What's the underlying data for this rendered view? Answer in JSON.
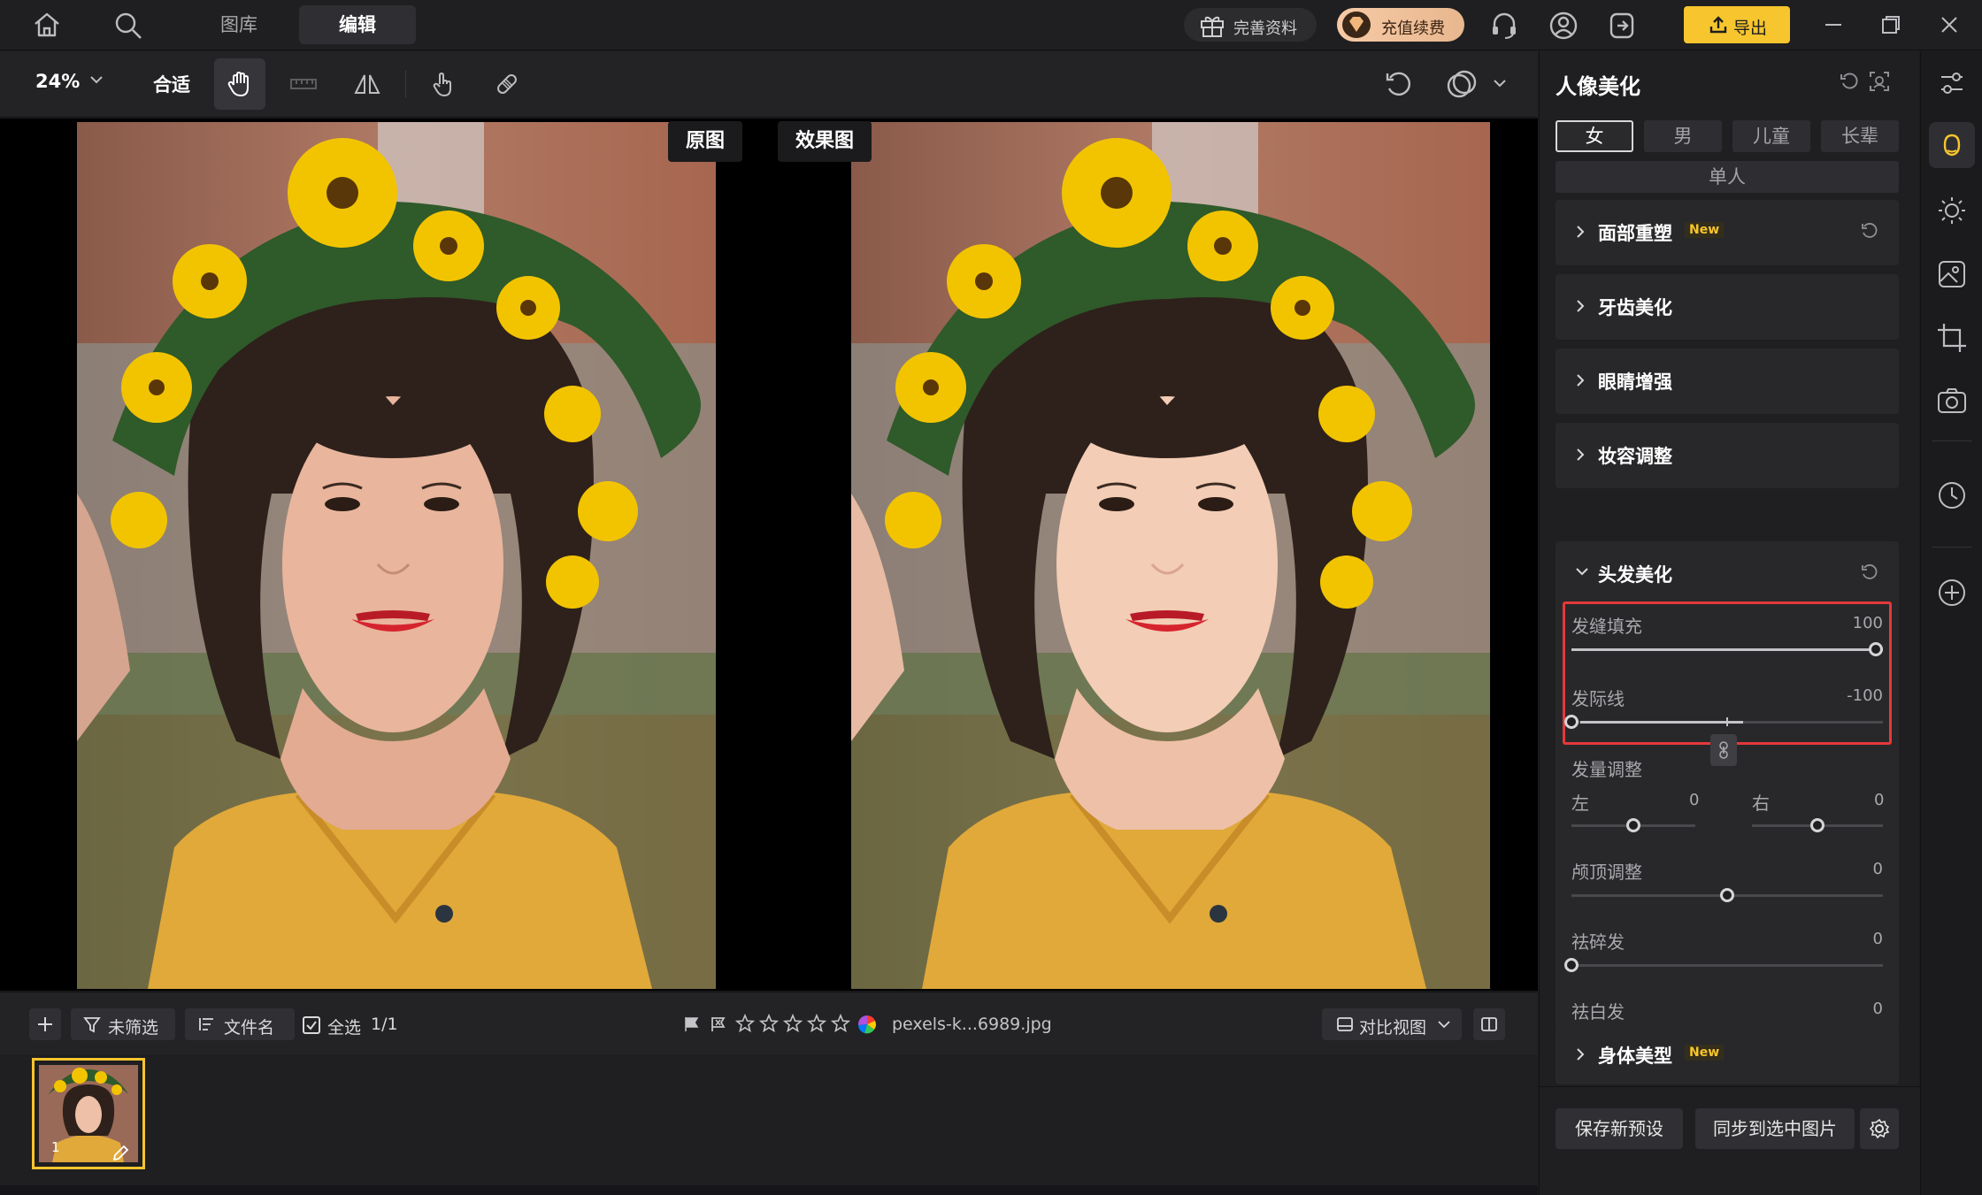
{
  "topbar": {
    "tabs": [
      {
        "label": "图库"
      },
      {
        "label": "编辑"
      }
    ],
    "gift_label": "完善资料",
    "vip_label": "充值续费",
    "export_label": "导出"
  },
  "toolbar": {
    "zoom": "24%",
    "fit_label": "合适"
  },
  "canvas": {
    "before_label": "原图",
    "after_label": "效果图"
  },
  "filmstrip": {
    "filter_label": "未筛选",
    "sort_label": "文件名",
    "select_all_label": "全选",
    "count": "1/1",
    "file_name": "pexels-k...6989.jpg",
    "view_mode_label": "对比视图",
    "thumb_number": "1",
    "rating_stars": 0
  },
  "panel": {
    "title": "人像美化",
    "gender_tabs": [
      {
        "label": "女"
      },
      {
        "label": "男"
      },
      {
        "label": "儿童"
      },
      {
        "label": "长辈"
      }
    ],
    "single_label": "单人",
    "sections": [
      {
        "label": "面部重塑",
        "badge": "New"
      },
      {
        "label": "牙齿美化"
      },
      {
        "label": "眼睛增强"
      },
      {
        "label": "妆容调整"
      }
    ],
    "hair": {
      "title": "头发美化",
      "hair_fill": {
        "label": "发缝填充",
        "value": "100"
      },
      "hairline": {
        "label": "发际线",
        "value": "-100"
      },
      "volume": {
        "label": "发量调整",
        "left_label": "左",
        "left_value": "0",
        "right_label": "右",
        "right_value": "0"
      },
      "crown": {
        "label": "颅顶调整",
        "value": "0"
      },
      "flyaway": {
        "label": "祛碎发",
        "value": "0"
      },
      "gray": {
        "label": "祛白发",
        "value": "0"
      }
    },
    "body": {
      "label": "身体美型",
      "badge": "New"
    },
    "save_preset_label": "保存新预设",
    "sync_label": "同步到选中图片"
  },
  "colors": {
    "accent": "#f7c52d",
    "highlight_box": "#e5383a",
    "panel_bg": "#1f1f21",
    "section_bg": "#28282b"
  }
}
